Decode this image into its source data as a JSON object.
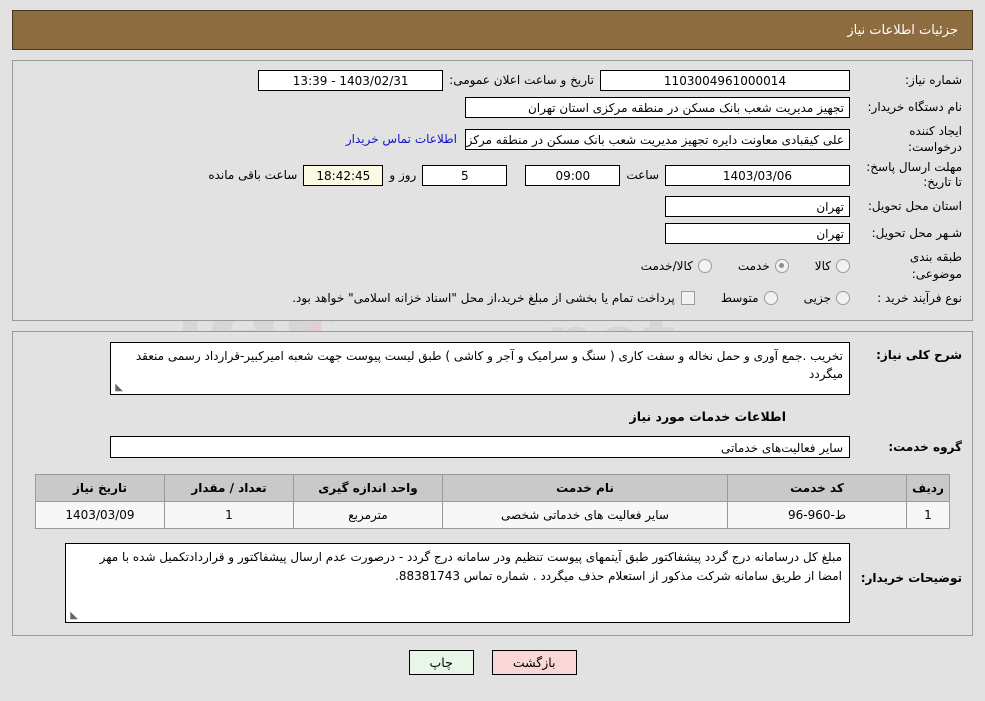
{
  "header": {
    "title": "جزئیات اطلاعات نیاز"
  },
  "top": {
    "need_number_label": "شماره نیاز:",
    "need_number_value": "1103004961000014",
    "announce_label": "تاریخ و ساعت اعلان عمومی:",
    "announce_value": "1403/02/31 - 13:39",
    "buyer_org_label": "نام دستگاه خریدار:",
    "buyer_org_value": "تجهیز مدیریت شعب بانک مسکن در منطقه مرکزی استان تهران",
    "creator_label": "ایجاد کننده درخواست:",
    "creator_value": "علی کیقبادی معاونت دایره تجهیز مدیریت شعب بانک مسکن در منطقه مرکزی ا",
    "contact_link": "اطلاعات تماس خریدار",
    "deadline_label": "مهلت ارسال پاسخ: تا تاریخ:",
    "deadline_date": "1403/03/06",
    "hour_label": "ساعت",
    "deadline_time": "09:00",
    "days_value": "5",
    "days_label": "روز و",
    "timer_value": "18:42:45",
    "remaining_label": "ساعت باقی مانده",
    "province_label": "استان محل تحویل:",
    "province_value": "تهران",
    "city_label": "شـهر محل تحویل:",
    "city_value": "تهران",
    "category_label": "طبقه بندی موضوعی:",
    "category_options": [
      {
        "label": "کالا",
        "checked": false
      },
      {
        "label": "خدمت",
        "checked": true
      },
      {
        "label": "کالا/خدمت",
        "checked": false
      }
    ],
    "process_label": "نوع فرآیند خرید :",
    "process_options": [
      {
        "label": "جزیی",
        "checked": false
      },
      {
        "label": "متوسط",
        "checked": false
      }
    ],
    "treasury_note": "پرداخت تمام یا بخشی از مبلغ خرید،از محل \"اسناد خزانه اسلامی\" خواهد بود."
  },
  "middle": {
    "summary_label": "شرح کلی نیاز:",
    "summary_value": "تخریب .جمع آوری و حمل نخاله و سفت کاری ( سنگ و سرامیک و آجر و کاشی ) طبق لیست پیوست جهت شعبه امیرکبیر-قرارداد رسمی منعقد میگردد",
    "section_title": "اطلاعات خدمات مورد نیاز",
    "service_group_label": "گروه خدمت:",
    "service_group_value": "سایر فعالیت‌های خدماتی",
    "table": {
      "headers": [
        "ردیف",
        "کد خدمت",
        "نام خدمت",
        "واحد اندازه گیری",
        "تعداد / مقدار",
        "تاریخ نیاز"
      ],
      "rows": [
        {
          "radif": "1",
          "code": "ط-960-96",
          "name": "سایر فعالیت های خدماتی شخصی",
          "unit": "مترمربع",
          "qty": "1",
          "date": "1403/03/09"
        }
      ]
    },
    "notes_label": "توضیحات خریدار:",
    "notes_value": "مبلغ کل درسامانه درج گردد پیشفاکتور طبق آیتمهای پیوست تنظیم ودر سامانه درج گردد -  درصورت عدم ارسال پیشفاکتور و قراردادتکمیل شده با مهر امضا از طریق سامانه شرکت مذکور از استعلام حذف میگردد .  شماره تماس 88381743."
  },
  "buttons": {
    "print": "چاپ",
    "back": "بازگشت"
  },
  "colors": {
    "header_bg": "#8d6c40",
    "link": "#1414c8",
    "table_header_bg": "#c9c9c9",
    "timer_bg": "#fbfbe4",
    "print_bg": "#e8f6e8",
    "back_bg": "#fbd6d6"
  }
}
